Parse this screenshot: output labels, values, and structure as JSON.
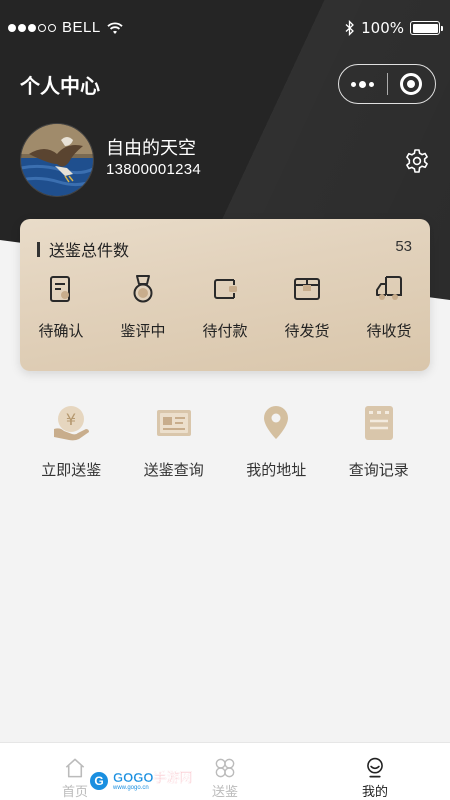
{
  "status_bar": {
    "carrier": "BELL",
    "battery": "100%"
  },
  "nav": {
    "title": "个人中心"
  },
  "profile": {
    "name": "自由的天空",
    "phone": "13800001234"
  },
  "orders": {
    "title": "送鉴总件数",
    "count": "53",
    "items": [
      {
        "label": "待确认",
        "icon": "doc-icon"
      },
      {
        "label": "鉴评中",
        "icon": "medal-icon"
      },
      {
        "label": "待付款",
        "icon": "wallet-icon"
      },
      {
        "label": "待发货",
        "icon": "box-icon"
      },
      {
        "label": "待收货",
        "icon": "truck-icon"
      }
    ]
  },
  "services": [
    {
      "label": "立即送鉴",
      "icon": "yen-hand-icon"
    },
    {
      "label": "送鉴查询",
      "icon": "card-icon"
    },
    {
      "label": "我的地址",
      "icon": "location-pin-icon"
    },
    {
      "label": "查询记录",
      "icon": "record-icon"
    }
  ],
  "tabbar": [
    {
      "label": "首页",
      "icon": "home-icon"
    },
    {
      "label": "送鉴",
      "icon": "clover-icon"
    },
    {
      "label": "我的",
      "icon": "profile-icon"
    }
  ],
  "watermark": {
    "logo": "G",
    "main_a": "GOGO",
    "main_b": "手游网",
    "sub": "www.gogo.cn"
  },
  "colors": {
    "header_bg": "#252525",
    "card_gold": "#e2d2bc",
    "icon_gold": "#c8ad8c",
    "page_bg": "#f3f3f3"
  }
}
